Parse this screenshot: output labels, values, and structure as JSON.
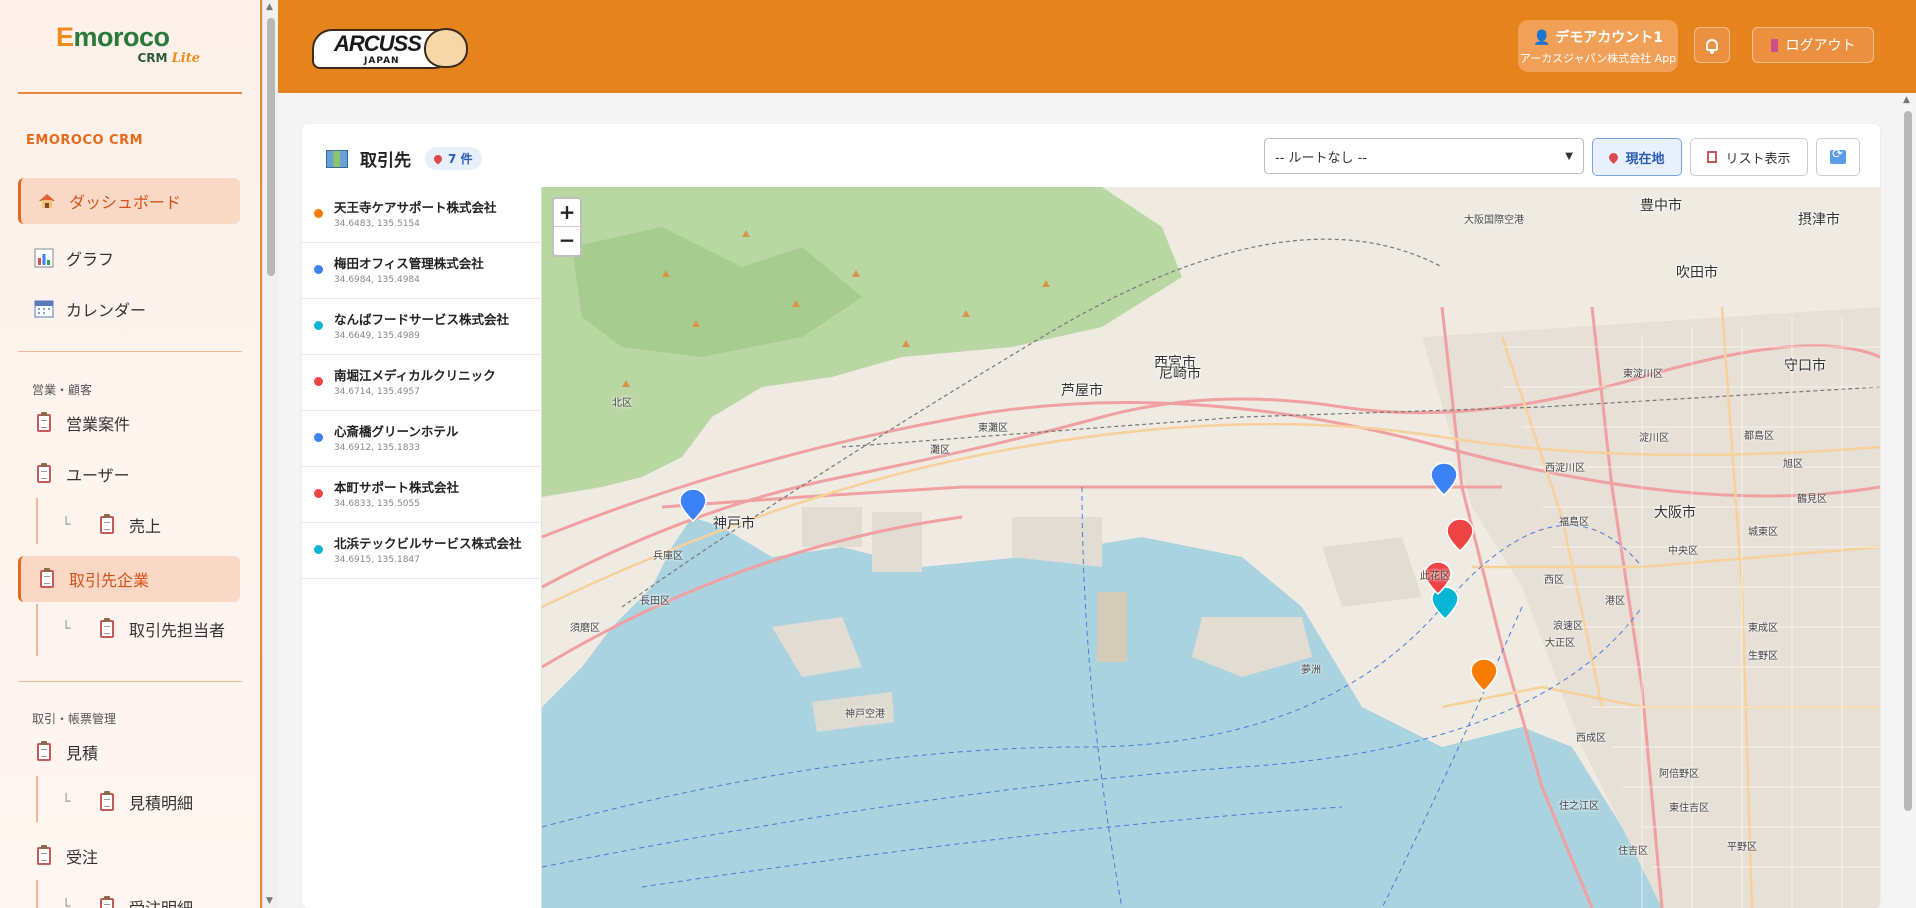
{
  "sidebar": {
    "logo_main": "moroco",
    "logo_e": "E",
    "logo_crm": "CRM",
    "logo_lite": "Lite",
    "brand": "EMOROCO CRM",
    "nav_dashboard": "ダッシュボード",
    "nav_graph": "グラフ",
    "nav_calendar": "カレンダー",
    "group_sales": "営業・顧客",
    "nav_deals": "営業案件",
    "nav_users": "ユーザー",
    "nav_sales": "売上",
    "nav_clients": "取引先企業",
    "nav_contacts": "取引先担当者",
    "group_docs": "取引・帳票管理",
    "nav_estimate": "見積",
    "nav_estimate_detail": "見積明細",
    "nav_order": "受注",
    "nav_order_detail": "受注明細"
  },
  "header": {
    "logo_name": "ARCUSS",
    "logo_sub": "JAPAN",
    "user_name": "デモアカウント1",
    "user_company": "アーカスジャパン株式会社 App",
    "logout_label": "ログアウト"
  },
  "panel": {
    "title": "取引先",
    "count": "7 件",
    "route_select": "-- ルートなし --",
    "btn_location": "現在地",
    "btn_list": "リスト表示"
  },
  "clients": [
    {
      "name": "天王寺ケアサポート株式会社",
      "coords": "34.6483, 135.5154",
      "color": "#f57c00"
    },
    {
      "name": "梅田オフィス管理株式会社",
      "coords": "34.6984, 135.4984",
      "color": "#3b82f6"
    },
    {
      "name": "なんばフードサービス株式会社",
      "coords": "34.6649, 135.4989",
      "color": "#06b6d4"
    },
    {
      "name": "南堀江メディカルクリニック",
      "coords": "34.6714, 135.4957",
      "color": "#ef4444"
    },
    {
      "name": "心斎橋グリーンホテル",
      "coords": "34.6912, 135.1833",
      "color": "#3b82f6"
    },
    {
      "name": "本町サポート株式会社",
      "coords": "34.6833, 135.5055",
      "color": "#ef4444"
    },
    {
      "name": "北浜テックビルサービス株式会社",
      "coords": "34.6915, 135.1847",
      "color": "#06b6d4"
    }
  ],
  "map": {
    "zoom_in": "+",
    "zoom_out": "−",
    "places": [
      {
        "name": "西宮市",
        "cls": ""
      },
      {
        "name": "尼崎市",
        "cls": ""
      },
      {
        "name": "芦屋市",
        "cls": ""
      },
      {
        "name": "神戸市",
        "cls": ""
      },
      {
        "name": "大阪市",
        "cls": ""
      },
      {
        "name": "吹田市",
        "cls": ""
      },
      {
        "name": "豊中市",
        "cls": ""
      },
      {
        "name": "摂津市",
        "cls": ""
      },
      {
        "name": "守口市",
        "cls": ""
      },
      {
        "name": "東灘区",
        "cls": "small"
      },
      {
        "name": "灘区",
        "cls": "small"
      },
      {
        "name": "北区",
        "cls": "small"
      },
      {
        "name": "中央区",
        "cls": "small"
      },
      {
        "name": "兵庫区",
        "cls": "small"
      },
      {
        "name": "長田区",
        "cls": "small"
      },
      {
        "name": "須磨区",
        "cls": "small"
      },
      {
        "name": "此花区",
        "cls": "small"
      },
      {
        "name": "港区",
        "cls": "small"
      },
      {
        "name": "大正区",
        "cls": "small"
      },
      {
        "name": "西成区",
        "cls": "small"
      },
      {
        "name": "住之江区",
        "cls": "small"
      },
      {
        "name": "住吉区",
        "cls": "small"
      },
      {
        "name": "阿倍野区",
        "cls": "small"
      },
      {
        "name": "東住吉区",
        "cls": "small"
      },
      {
        "name": "平野区",
        "cls": "small"
      },
      {
        "name": "生野区",
        "cls": "small"
      },
      {
        "name": "東成区",
        "cls": "small"
      },
      {
        "name": "城東区",
        "cls": "small"
      },
      {
        "name": "鶴見区",
        "cls": "small"
      },
      {
        "name": "旭区",
        "cls": "small"
      },
      {
        "name": "都島区",
        "cls": "small"
      },
      {
        "name": "淀川区",
        "cls": "small"
      },
      {
        "name": "西淀川区",
        "cls": "small"
      },
      {
        "name": "福島区",
        "cls": "small"
      },
      {
        "name": "西区",
        "cls": "small"
      },
      {
        "name": "浪速区",
        "cls": "small"
      },
      {
        "name": "東淀川区",
        "cls": "small"
      },
      {
        "name": "神戸空港",
        "cls": "small"
      },
      {
        "name": "夢洲",
        "cls": "small"
      },
      {
        "name": "大阪国際空港",
        "cls": "small"
      }
    ]
  },
  "colors": {
    "accent": "#e5831c",
    "sidebar_active": "#f9d9c6",
    "water": "#aad3df",
    "land": "#f2efe9",
    "forest": "#add19e"
  }
}
